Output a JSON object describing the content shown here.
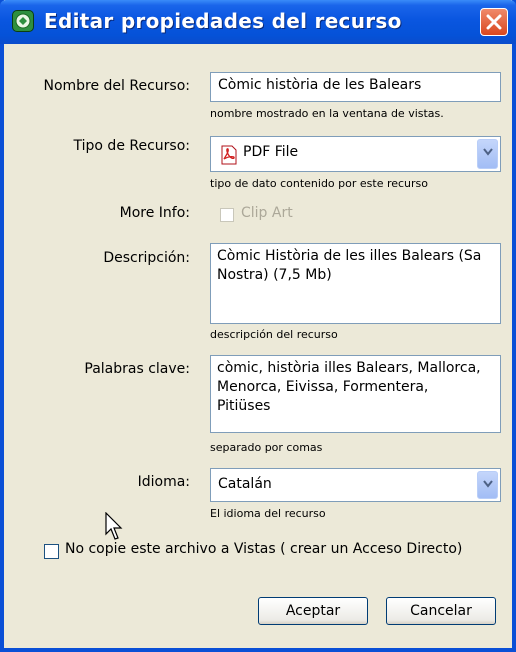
{
  "window": {
    "title": "Editar propiedades del recurso",
    "close_icon": "close-icon"
  },
  "fields": {
    "nombre": {
      "label": "Nombre del Recurso:",
      "value": "Còmic història de les Balears",
      "hint": "nombre mostrado en la ventana de vistas."
    },
    "tipo": {
      "label": "Tipo de Recurso:",
      "value": "PDF File",
      "icon": "pdf-file-icon",
      "hint": "tipo de dato contenido por este recurso"
    },
    "more_info": {
      "label": "More Info:",
      "checkbox_label": "Clip Art",
      "checked": false,
      "disabled": true
    },
    "descripcion": {
      "label": "Descripción:",
      "value": "Còmic Història de les illes Balears (Sa\nNostra) (7,5 Mb)",
      "hint": "descripción del recurso"
    },
    "palabras": {
      "label": "Palabras clave:",
      "value": "còmic, història illes Balears, Mallorca,\nMenorca, Eivissa, Formentera,\nPitiüses",
      "hint": "separado por comas"
    },
    "idioma": {
      "label": "Idioma:",
      "value": "Catalán",
      "hint": "El idioma del recurso"
    }
  },
  "no_copy": {
    "label": "No copie este archivo a Vistas ( crear un Acceso Directo)",
    "checked": false
  },
  "buttons": {
    "accept": "Aceptar",
    "cancel": "Cancelar"
  },
  "colors": {
    "titlebar": "#0a56e0",
    "dialog_bg": "#ece9d8",
    "close_button": "#d9471f"
  }
}
